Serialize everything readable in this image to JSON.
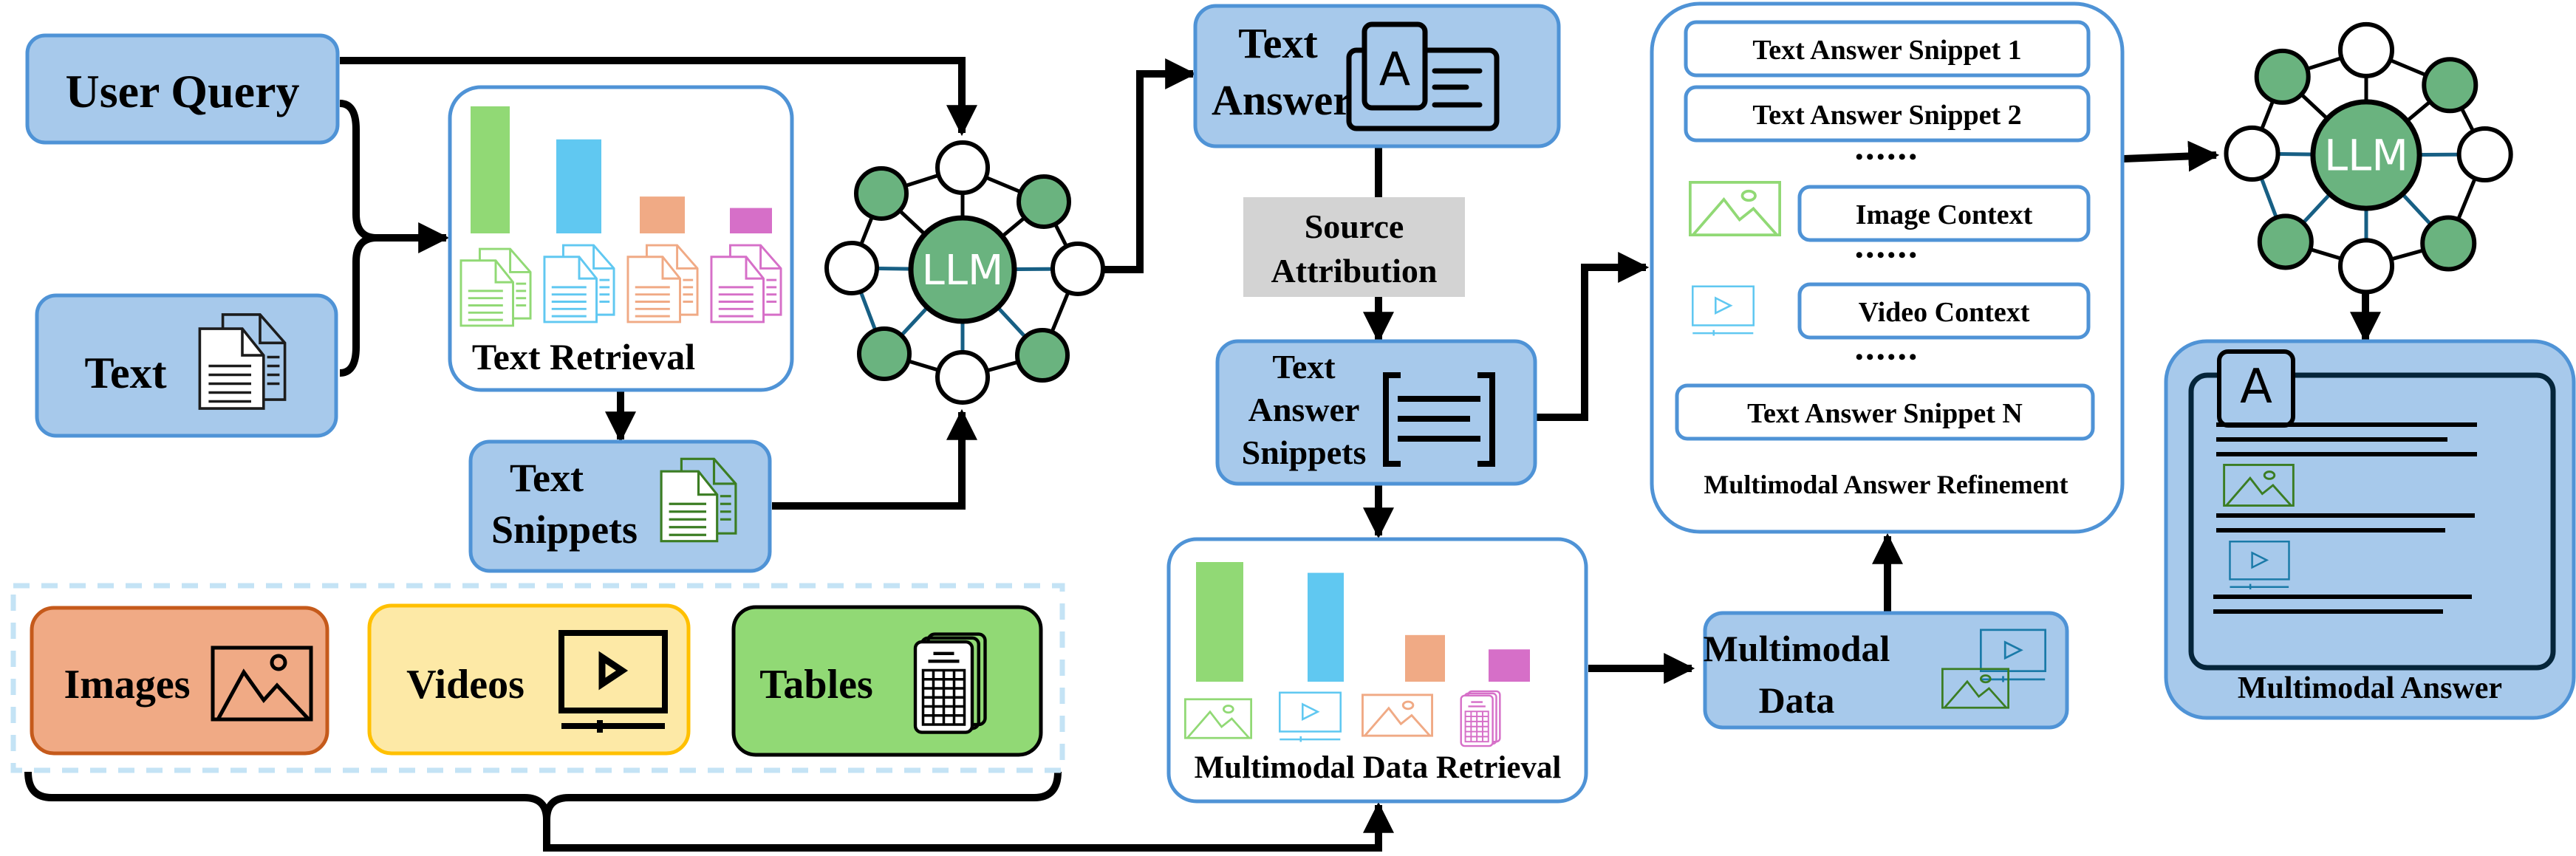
{
  "colors": {
    "box_fill": "#a7c9eb",
    "box_border": "#4f93d6",
    "green": "#91d975",
    "cyan": "#60c8f1",
    "orange": "#f0aa85",
    "magenta": "#d66fc8",
    "llm_green": "#6ab37f",
    "edge_teal": "#175f84",
    "gray": "#d3d3d3",
    "dark_green": "#3b7d23",
    "teal_icon": "#1a7aa8",
    "images_fill": "#f0aa85",
    "images_border": "#c55a1b",
    "videos_fill": "#fde9a6",
    "videos_border": "#ffc000",
    "tables_fill": "#91d975",
    "dash": "#c4e3f5"
  },
  "inputs": {
    "user_query": "User Query",
    "text": "Text"
  },
  "text_retrieval": {
    "label": "Text Retrieval",
    "relevance": [
      1.0,
      0.74,
      0.29,
      0.2
    ],
    "icon": "document-stack-icon"
  },
  "text_snippets": {
    "line1": "Text",
    "line2": "Snippets"
  },
  "llm_label": "LLM",
  "text_answer": {
    "line1": "Text",
    "line2": "Answer",
    "icon_letter": "A"
  },
  "source_attribution": {
    "line1": "Source",
    "line2": "Attribution"
  },
  "text_answer_snippets": {
    "line1": "Text",
    "line2": "Answer",
    "line3": "Snippets"
  },
  "multimodal_retrieval": {
    "label": "Multimodal Data Retrieval",
    "relevance": [
      1.0,
      0.91,
      0.39,
      0.27
    ],
    "icons": [
      "image-icon",
      "video-icon",
      "image-icon",
      "table-icon"
    ]
  },
  "multimodal_data": {
    "line1": "Multimodal",
    "line2": "Data"
  },
  "modalities": [
    {
      "label": "Images",
      "icon": "image-icon"
    },
    {
      "label": "Videos",
      "icon": "video-icon"
    },
    {
      "label": "Tables",
      "icon": "table-icon"
    }
  ],
  "refinement": {
    "title": "Multimodal Answer Refinement",
    "items": [
      "Text Answer Snippet 1",
      "Text Answer Snippet 2",
      "Image Context",
      "Video Context",
      "Text Answer Snippet N"
    ],
    "ellipsis": "••••••"
  },
  "multimodal_answer": {
    "label": "Multimodal Answer",
    "icon_letter": "A"
  }
}
